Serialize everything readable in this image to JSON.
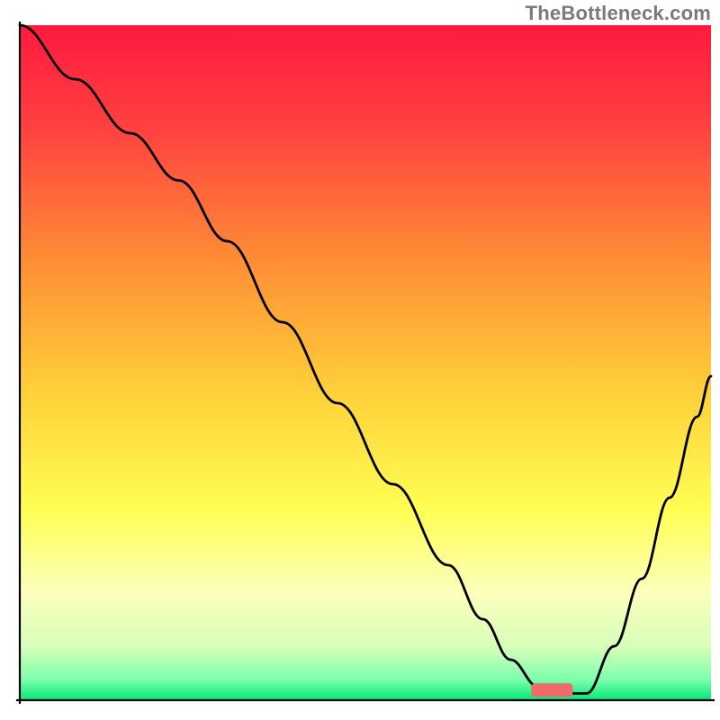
{
  "watermark": "TheBottleneck.com",
  "chart_data": {
    "type": "line",
    "title": "",
    "xlabel": "",
    "ylabel": "",
    "xlim": [
      0,
      100
    ],
    "ylim": [
      0,
      100
    ],
    "grid": false,
    "legend": false,
    "background_gradient": {
      "stops": [
        {
          "offset": 0.0,
          "color": "#ff1a3f"
        },
        {
          "offset": 0.15,
          "color": "#ff4040"
        },
        {
          "offset": 0.35,
          "color": "#ff8e35"
        },
        {
          "offset": 0.55,
          "color": "#ffd23a"
        },
        {
          "offset": 0.72,
          "color": "#ffff55"
        },
        {
          "offset": 0.84,
          "color": "#fcffbb"
        },
        {
          "offset": 0.92,
          "color": "#d8ffba"
        },
        {
          "offset": 0.97,
          "color": "#7cffac"
        },
        {
          "offset": 1.0,
          "color": "#00e878"
        }
      ]
    },
    "series": [
      {
        "name": "curve",
        "stroke": "#000000",
        "stroke_width": 2.8,
        "x": [
          0,
          8,
          16,
          23,
          30,
          38,
          46,
          54,
          62,
          67,
          71,
          75,
          78,
          82,
          86,
          90,
          94,
          98,
          100
        ],
        "y": [
          100,
          92,
          84,
          77,
          68,
          56,
          44,
          32,
          20,
          12,
          6,
          2,
          1,
          1,
          8,
          18,
          30,
          42,
          48
        ]
      }
    ],
    "marker": {
      "name": "target-range",
      "color": "#ef6a6a",
      "x_center": 77,
      "y": 1.5,
      "width_x": 6,
      "height_y": 2,
      "rx": 4
    },
    "axes": {
      "stroke": "#000000",
      "stroke_width": 2.2
    }
  }
}
